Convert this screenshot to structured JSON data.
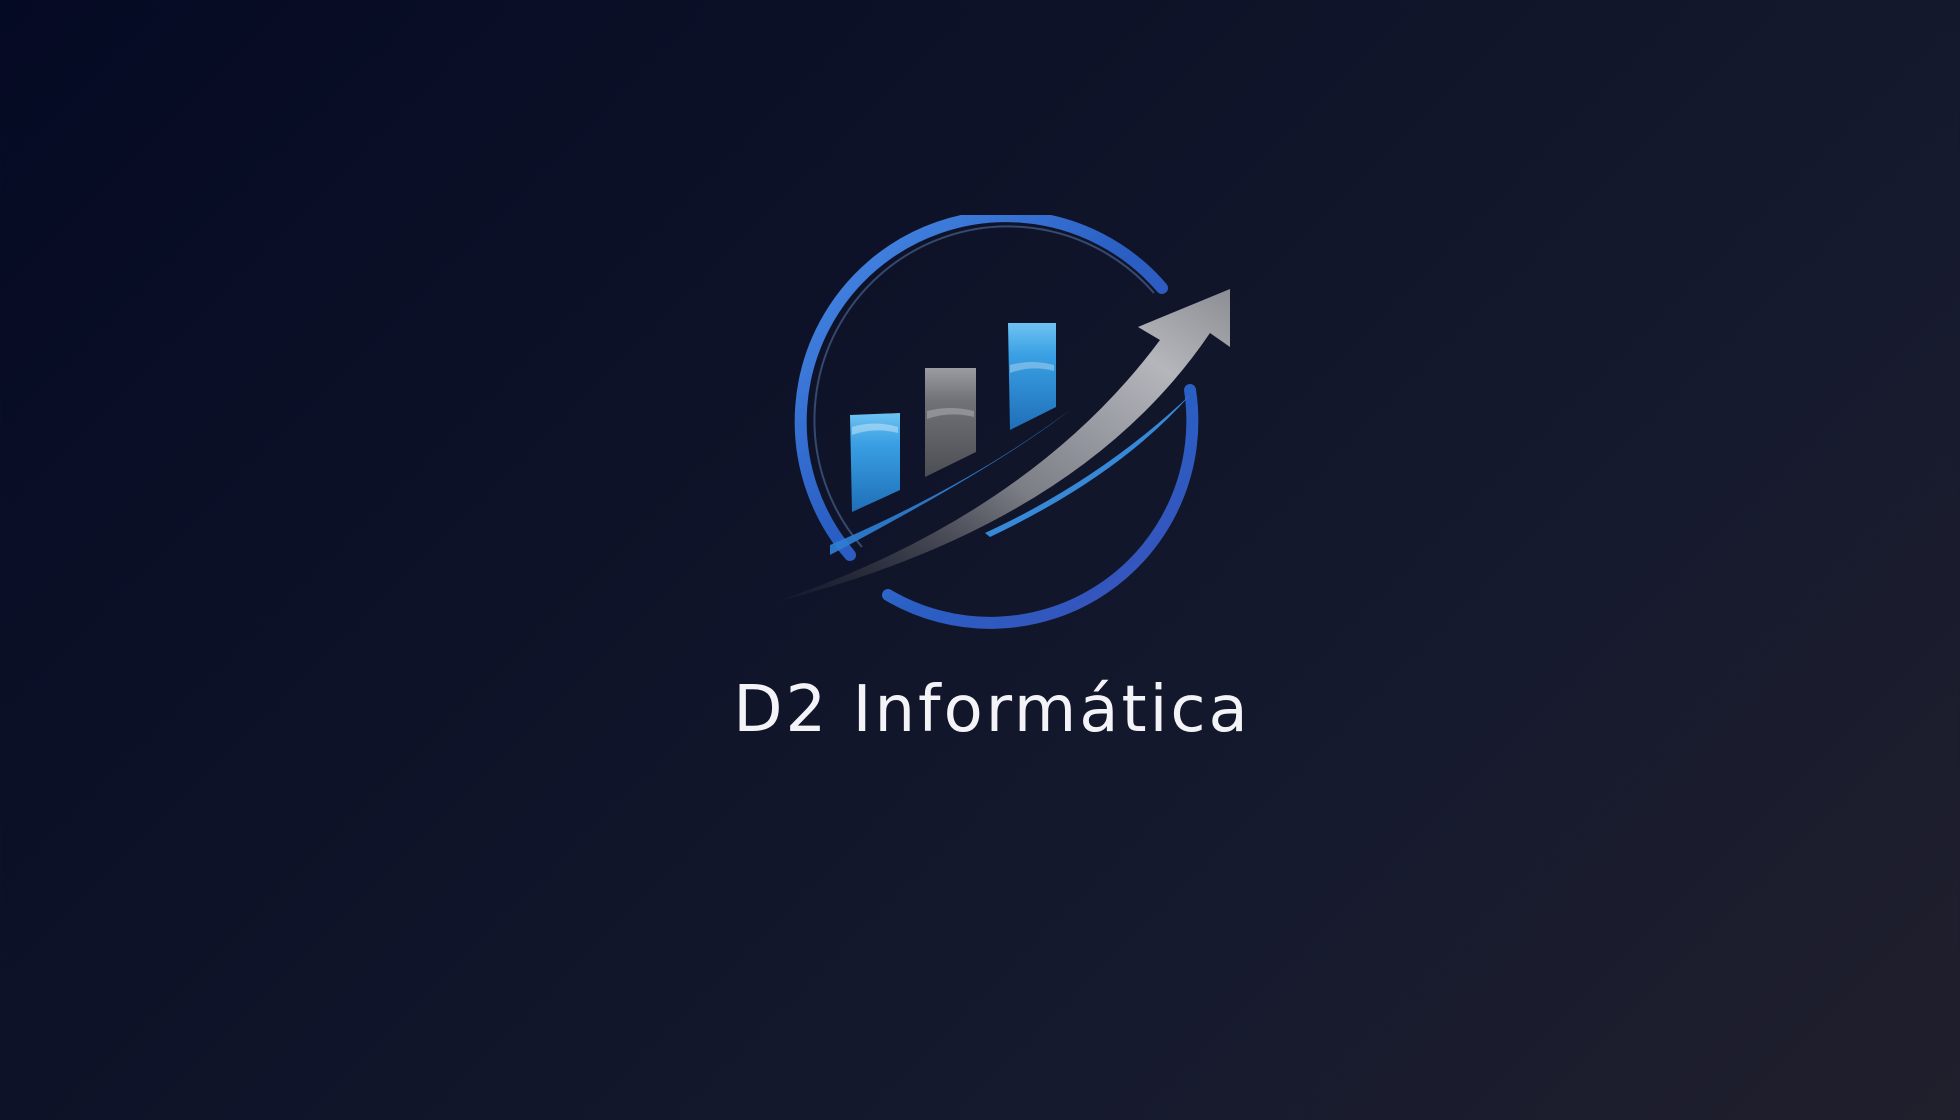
{
  "splash": {
    "brand_name": "D2 Informática",
    "logo_icon": "growth-chart-logo-icon"
  },
  "colors": {
    "background_start": "#050a24",
    "background_end": "#201f2c",
    "ring_blue": "#2f6fd6",
    "bar_blue": "#2f8fd8",
    "bar_gray": "#6a6c72",
    "arrow_gray": "#8a8c92",
    "text": "#f4f4f8"
  }
}
